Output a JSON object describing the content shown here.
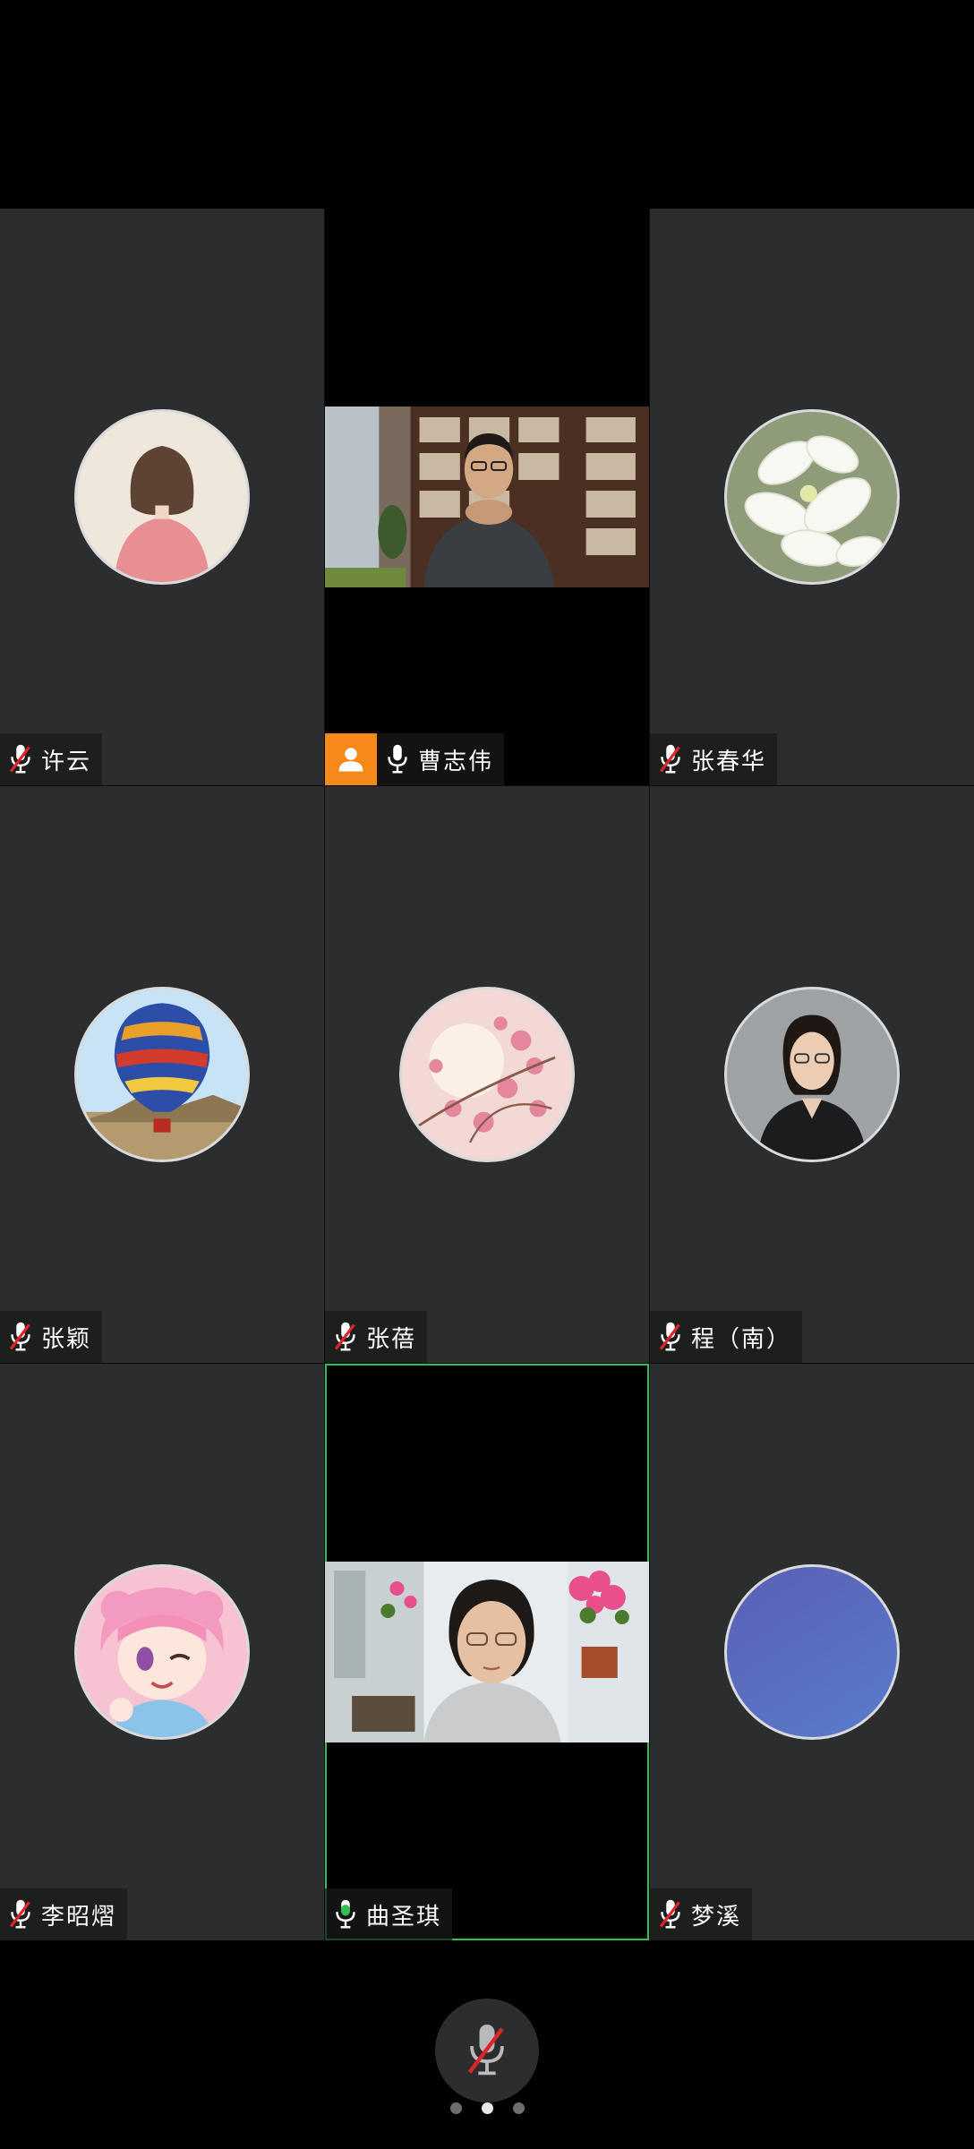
{
  "participants": [
    {
      "name": "许云",
      "mic": "muted",
      "display": "avatar",
      "avatar_icon": "girl-back-avatar-icon"
    },
    {
      "name": "曹志伟",
      "mic": "on",
      "display": "video",
      "host": true
    },
    {
      "name": "张春华",
      "mic": "muted",
      "display": "avatar",
      "avatar_icon": "white-lily-avatar-icon"
    },
    {
      "name": "张颖",
      "mic": "muted",
      "display": "avatar",
      "avatar_icon": "hot-air-balloon-avatar-icon"
    },
    {
      "name": "张蓓",
      "mic": "muted",
      "display": "avatar",
      "avatar_icon": "cherry-blossom-avatar-icon"
    },
    {
      "name": "程（南）",
      "mic": "muted",
      "display": "avatar",
      "avatar_icon": "woman-portrait-avatar-icon"
    },
    {
      "name": "李昭熠",
      "mic": "muted",
      "display": "avatar",
      "avatar_icon": "anime-girl-avatar-icon"
    },
    {
      "name": "曲圣琪",
      "mic": "speaking",
      "display": "video",
      "active_speaker": true
    },
    {
      "name": "梦溪",
      "mic": "muted",
      "display": "avatar",
      "avatar_icon": "blue-gradient-avatar-icon"
    }
  ],
  "controls": {
    "self_mic": "muted",
    "self_mic_icon": "mic-muted-icon"
  },
  "pager": {
    "pages": 3,
    "current_page": 2
  },
  "colors": {
    "tile_bg": "#2b2d2f",
    "active_speaker_border": "#2fbf55",
    "host_badge": "#f7891b",
    "muted_slash": "#e0252a",
    "speaking_level": "#2fbf55"
  }
}
